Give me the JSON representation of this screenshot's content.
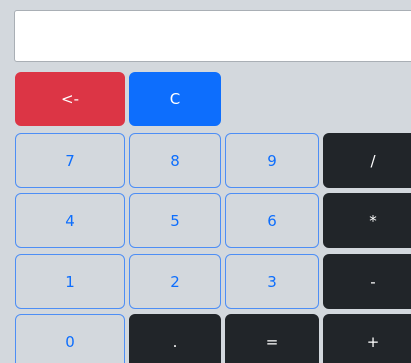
{
  "display": {
    "value": "",
    "placeholder": ""
  },
  "keys": {
    "backspace": "<-",
    "clear": "C",
    "seven": "7",
    "eight": "8",
    "nine": "9",
    "divide": "/",
    "four": "4",
    "five": "5",
    "six": "6",
    "multiply": "*",
    "one": "1",
    "two": "2",
    "three": "3",
    "subtract": "-",
    "zero": "0",
    "decimal": ".",
    "equals": "=",
    "add": "+"
  },
  "colors": {
    "panel": "#d3d8dd",
    "danger": "#dc3545",
    "primary": "#0d6efd",
    "dark": "#212529",
    "outline": "#4d8ef5"
  }
}
